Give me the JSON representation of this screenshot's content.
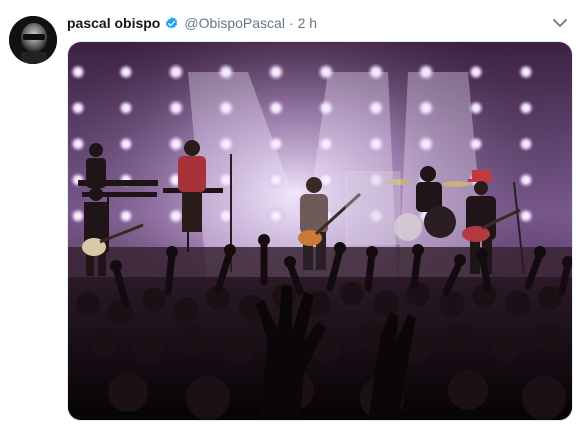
{
  "tweet": {
    "author_name": "pascal obispo",
    "handle": "@ObispoPascal",
    "separator": "·",
    "time": "2 h",
    "verified": true
  },
  "media": {
    "kind": "photo",
    "description_icon": "concert-photo"
  },
  "icons": {
    "verified": "verified-badge-icon",
    "more": "chevron-down-icon"
  },
  "colors": {
    "verified": "#1da1f2",
    "name": "#14171a",
    "secondary": "#657786",
    "stage_light": "#f3e9ff",
    "stage_tint": "#8e6aa8"
  }
}
